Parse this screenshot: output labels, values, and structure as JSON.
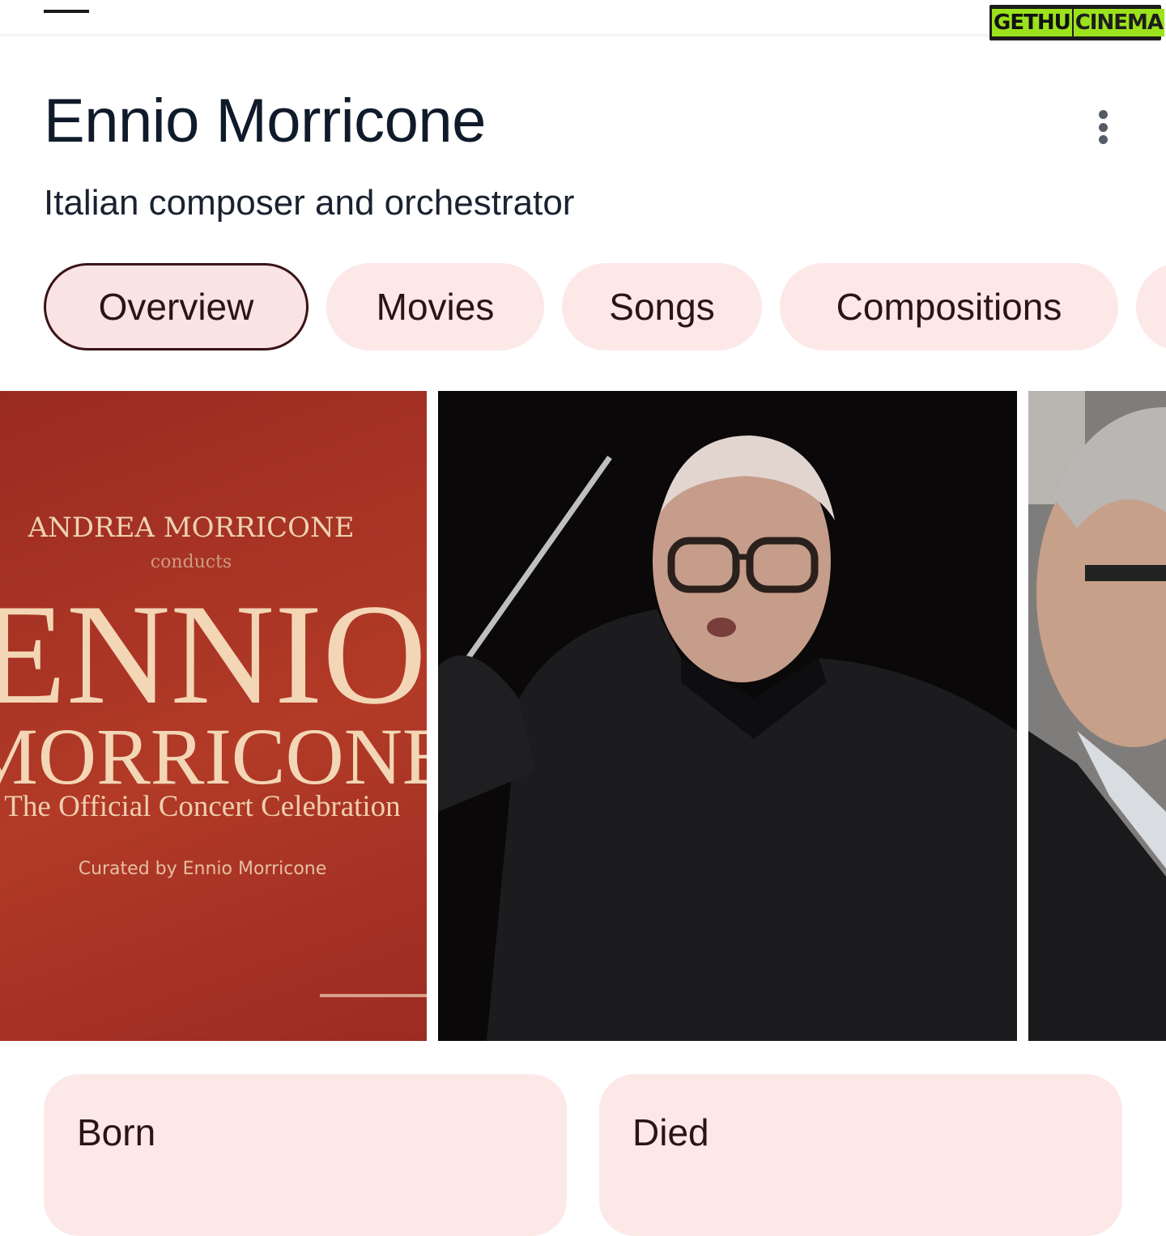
{
  "header": {
    "watermark": "GETHU CINEMA",
    "watermark_part1": "GETHU",
    "watermark_part2": "CINEMA"
  },
  "entity": {
    "title": "Ennio Morricone",
    "subtitle": "Italian composer and orchestrator"
  },
  "tabs": [
    {
      "label": "Overview",
      "active": true
    },
    {
      "label": "Movies",
      "active": false
    },
    {
      "label": "Songs",
      "active": false
    },
    {
      "label": "Compositions",
      "active": false
    }
  ],
  "gallery": {
    "album_cover": {
      "line1": "ANDREA MORRICONE",
      "line2": "conducts",
      "line3": "ENNIO",
      "line4": "MORRICONE",
      "line5": "The Official Concert Celebration",
      "line6": "Curated by Ennio Morricone"
    }
  },
  "facts": [
    {
      "label": "Born"
    },
    {
      "label": "Died"
    }
  ],
  "colors": {
    "chip_bg": "#fde8e8",
    "chip_text": "#2a1416",
    "title_text": "#0f1b2b",
    "album_red": "#a8321f",
    "album_text": "#f3d6b5"
  }
}
